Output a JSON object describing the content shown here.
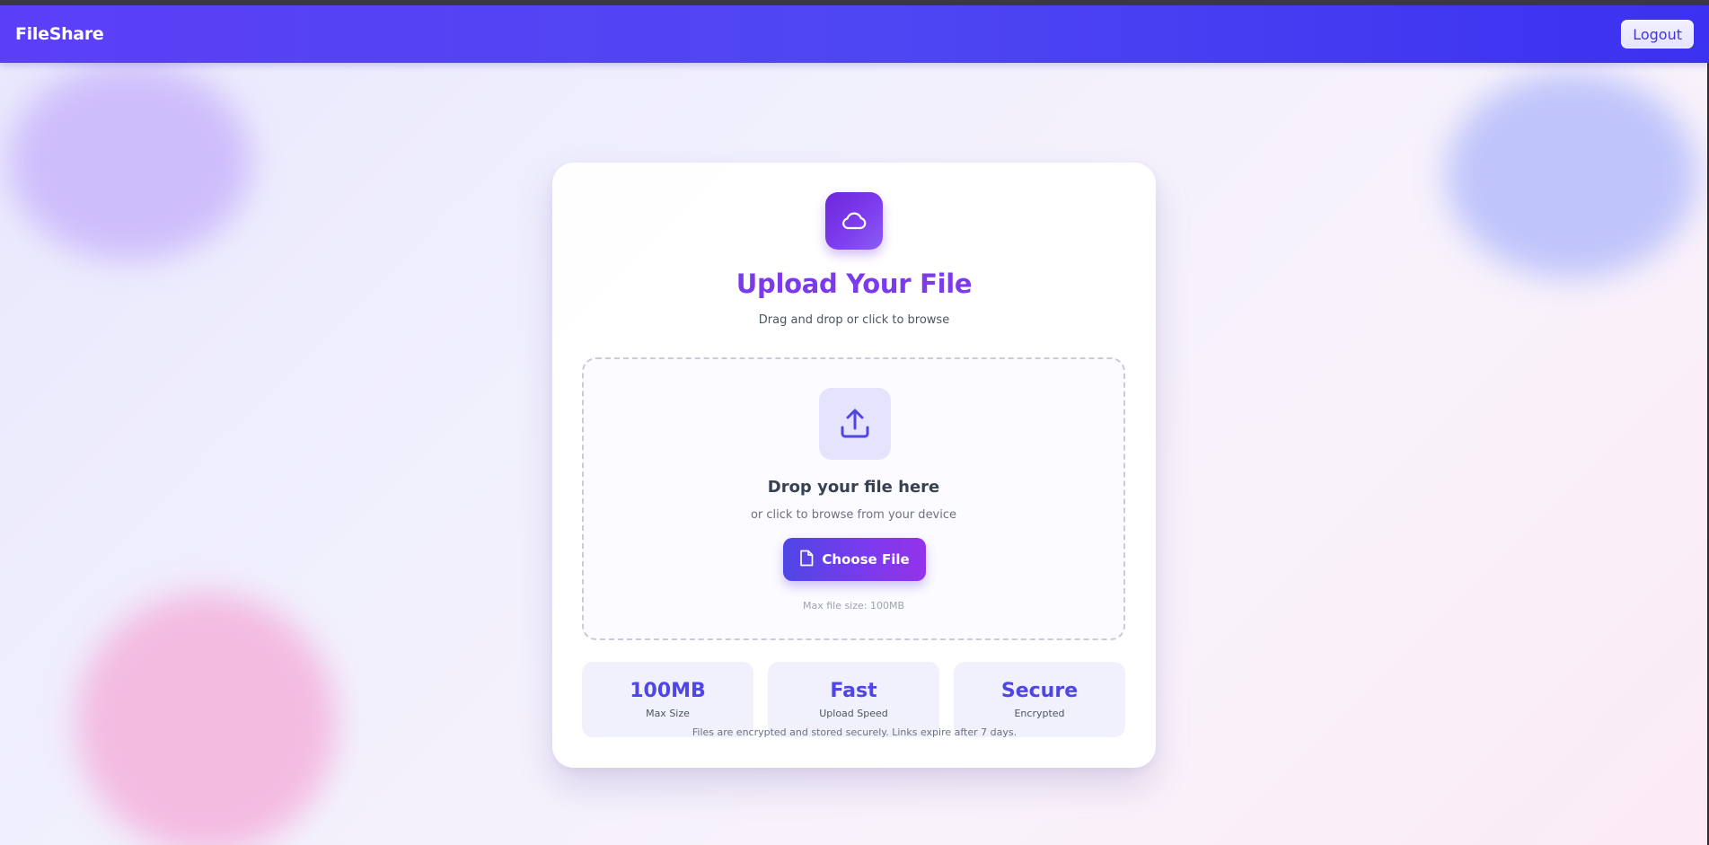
{
  "navbar": {
    "brand": "FileShare",
    "logout_label": "Logout"
  },
  "card": {
    "icon": "cloud-icon",
    "title": "Upload Your File",
    "subtitle": "Drag and drop or click to browse"
  },
  "dropzone": {
    "icon": "upload-icon",
    "title": "Drop your file here",
    "subtitle": "or click to browse from your device",
    "button_label": "Choose File",
    "button_icon": "file-icon",
    "max_note": "Max file size: 100MB"
  },
  "stats": [
    {
      "value": "100MB",
      "label": "Max Size"
    },
    {
      "value": "Fast",
      "label": "Upload Speed"
    },
    {
      "value": "Secure",
      "label": "Encrypted"
    }
  ],
  "footer": {
    "note": "Files are encrypted and stored securely. Links expire after 7 days."
  },
  "colors": {
    "accent": "#4f46e5",
    "title": "#7c3aed",
    "navbar": "#4f46f3"
  }
}
